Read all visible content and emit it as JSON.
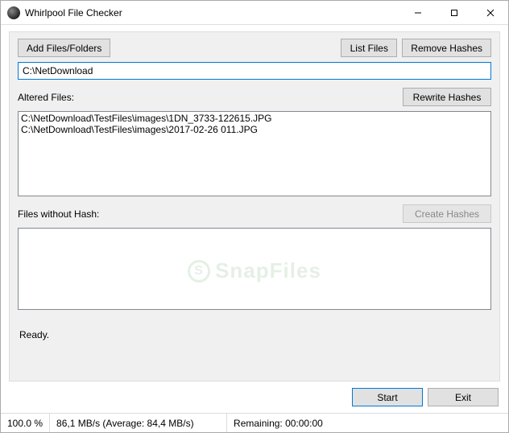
{
  "window": {
    "title": "Whirlpool File Checker"
  },
  "toolbar": {
    "add_files_label": "Add Files/Folders",
    "list_files_label": "List Files",
    "remove_hashes_label": "Remove Hashes"
  },
  "path": {
    "value": "C:\\NetDownload"
  },
  "altered": {
    "label": "Altered Files:",
    "rewrite_label": "Rewrite Hashes",
    "items": [
      "C:\\NetDownload\\TestFiles\\images\\1DN_3733-122615.JPG",
      "C:\\NetDownload\\TestFiles\\images\\2017-02-26 011.JPG"
    ]
  },
  "nohash": {
    "label": "Files without Hash:",
    "create_label": "Create Hashes",
    "items": []
  },
  "status": {
    "message": "Ready."
  },
  "footer": {
    "start_label": "Start",
    "exit_label": "Exit"
  },
  "statusbar": {
    "progress": "100.0 %",
    "speed": "86,1 MB/s  (Average:  84,4 MB/s)",
    "remaining": "Remaining:  00:00:00"
  },
  "watermark": {
    "text": "SnapFiles",
    "icon_letter": "S"
  }
}
